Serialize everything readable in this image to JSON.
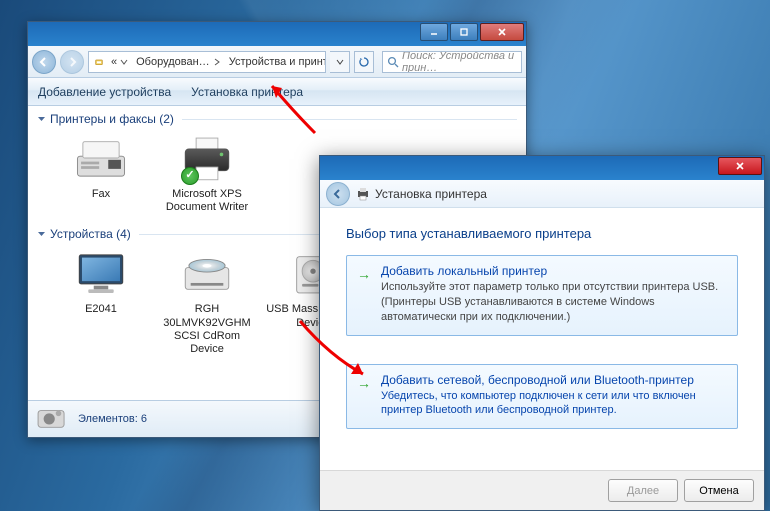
{
  "explorer": {
    "breadcrumb": {
      "seg1": "Оборудован…",
      "seg2": "Устройства и принтеры"
    },
    "search_placeholder": "Поиск: Устройства и прин…",
    "cmd": {
      "add_device": "Добавление устройства",
      "add_printer": "Установка принтера"
    },
    "groups": {
      "printers": {
        "label": "Принтеры и факсы (2)"
      },
      "devices": {
        "label": "Устройства (4)"
      }
    },
    "items": {
      "fax": "Fax",
      "xps": "Microsoft XPS Document Writer",
      "e2041": "E2041",
      "rgh": "RGH 30LMVK92VGHM SCSI CdRom Device",
      "usb": "USB Mass Storage Device"
    },
    "status": {
      "label": "Элементов: 6"
    }
  },
  "wizard": {
    "title": "Установка принтера",
    "heading": "Выбор типа устанавливаемого принтера",
    "opt1": {
      "title": "Добавить локальный принтер",
      "desc": "Используйте этот параметр только при отсутствии принтера USB. (Принтеры USB устанавливаются в системе Windows автоматически при их подключении.)"
    },
    "opt2": {
      "title": "Добавить сетевой, беспроводной или Bluetooth-принтер",
      "desc": "Убедитесь, что компьютер подключен к сети или что включен принтер Bluetooth или беспроводной принтер."
    },
    "next": "Далее",
    "cancel": "Отмена"
  }
}
